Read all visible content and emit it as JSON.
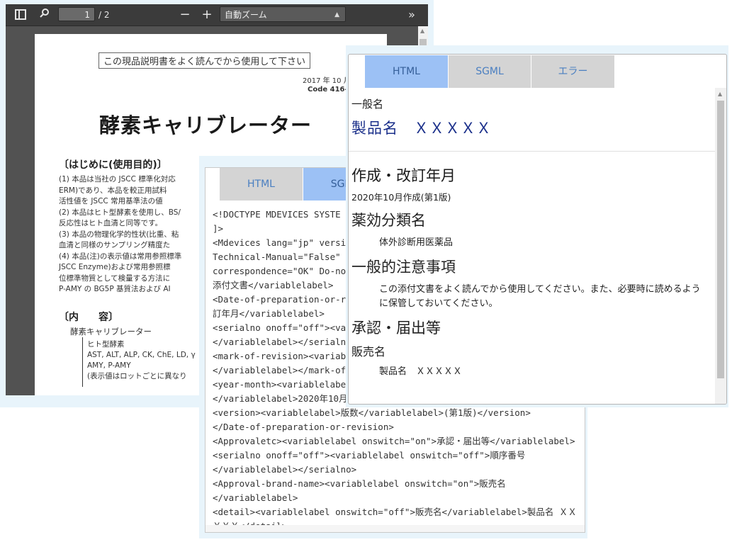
{
  "pdf_viewer": {
    "page_number": "1",
    "page_total": "/ 2",
    "zoom": "自動ズーム",
    "page": {
      "banner": "この現品説明書をよく読んでから使用して下さい",
      "date": "2017 年 10 月",
      "code": "Code 416-5",
      "title": "酵素キャリブレーター",
      "section1": "〔はじめに(使用目的)〕",
      "list": [
        "(1)  本品は当社の JSCC 標準化対応",
        "       ERM)であり、本品を較正用試料",
        "       活性値を JSCC 常用基準法の値",
        "(2)  本品はヒト型酵素を使用し、BS/",
        "       反応性はヒト血清と同等です。",
        "(3)  本品の物理化学的性状(比重、粘",
        "       血清と同様のサンプリング精度た",
        "(4)  本品(注)の表示値は常用参照標準",
        "       JSCC Enzyme)および常用参照標",
        "       位標準物質として検量する方法に",
        "       P-AMY の BG5P 基質法および AI"
      ],
      "section2": "〔内　　容〕",
      "sub": "酵素キャリブレーター",
      "items": [
        "ヒト型酵素",
        "AST, ALT, ALP, CK, ChE, LD, γ",
        "AMY, P-AMY",
        "(表示値はロットごとに異なり"
      ]
    }
  },
  "sgml_editor": {
    "tabs": [
      "HTML",
      "SGML"
    ],
    "lines": [
      "<!DOCTYPE MDEVICES SYSTE",
      "]>",
      "<Mdevices lang=\"jp\" version",
      "Technical-Manual=\"False\" El",
      "correspondence=\"OK\" Do-no",
      "添付文書</variablelabel>",
      "<Date-of-preparation-or-revisi",
      "訂年月</variablelabel>",
      "<serialno onoff=\"off\"><varia",
      "</variablelabel></serialno>",
      "<mark-of-revision><variable",
      "</variablelabel></mark-of-r",
      "<year-month><variablelabel",
      "</variablelabel>2020年10月作",
      "<version><variablelabel>版数</variablelabel>(第1版)</version>",
      "</Date-of-preparation-or-revision>",
      "<Approvaletc><variablelabel onswitch=\"on\">承認・届出等</variablelabel>",
      "<serialno onoff=\"off\"><variablelabel onswitch=\"off\">順序番号",
      "</variablelabel></serialno>",
      "<Approval-brand-name><variablelabel onswitch=\"on\">販売名",
      "</variablelabel>",
      "<detail><variablelabel onswitch=\"off\">販売名</variablelabel>製品名 ＸＸ",
      "ＸＸＸ</detail>"
    ]
  },
  "html_preview": {
    "tabs": [
      "HTML",
      "SGML",
      "エラー"
    ],
    "general_name_label": "一般名",
    "product": "製品名　ＸＸＸＸＸ",
    "h_revision": "作成・改訂年月",
    "revision_text": "2020年10月作成(第1版)",
    "h_category": "薬効分類名",
    "category_text": "体外診断用医薬品",
    "h_caution": "一般的注意事項",
    "caution_text": "この添付文書をよく読んでから使用してください。また、必要時に読めるように保管しておいてください。",
    "h_approval": "承認・届出等",
    "brand_label": "販売名",
    "brand_text": "製品名　ＸＸＸＸＸ"
  }
}
